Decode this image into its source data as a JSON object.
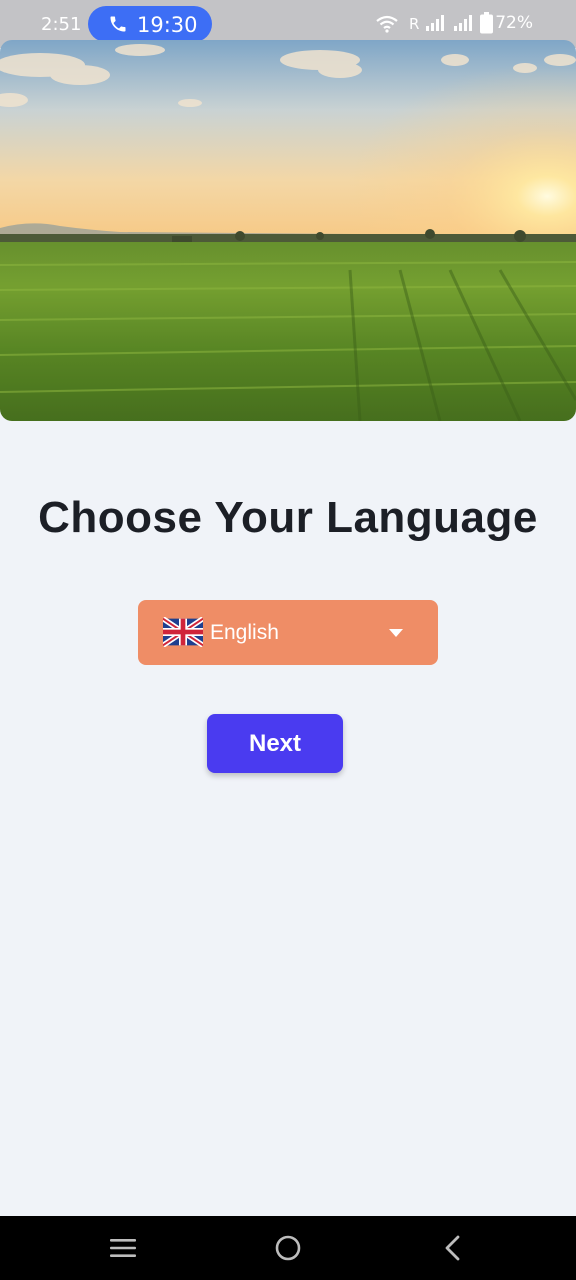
{
  "status_bar": {
    "time": "2:51",
    "call_timer": "19:30",
    "roaming_indicator": "R",
    "battery": "72%",
    "icons": [
      "phone-icon",
      "wifi-icon",
      "signal-icon",
      "signal-icon",
      "battery-icon"
    ]
  },
  "hero": {
    "image": "landscape-field-sunset"
  },
  "main": {
    "title": "Choose Your Language",
    "language_select": {
      "selected_value": "English",
      "flag": "uk-flag-icon",
      "color": "#ef8d66"
    },
    "next_label": "Next",
    "next_color": "#4a3bf0"
  },
  "nav_bar": {
    "items": [
      "menu-icon",
      "home-icon",
      "back-icon"
    ]
  }
}
